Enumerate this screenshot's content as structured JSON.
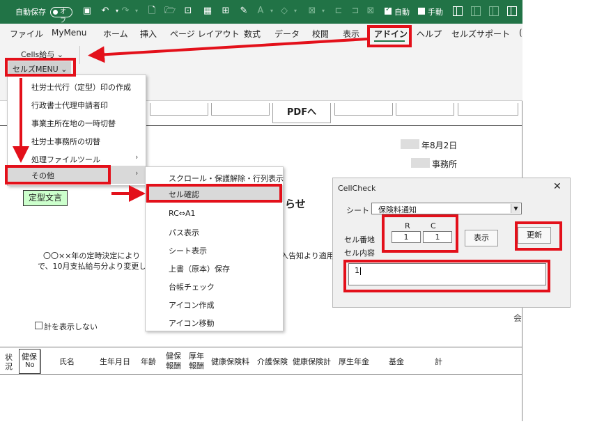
{
  "titlebar": {
    "autosave_label": "自動保存",
    "autosave_state": "オフ",
    "auto_label": "自動",
    "manual_label": "手動"
  },
  "tabs": [
    {
      "label": "ファイル"
    },
    {
      "label": "MyMenu"
    },
    {
      "label": "ホーム"
    },
    {
      "label": "挿入"
    },
    {
      "label": "ページ レイアウト"
    },
    {
      "label": "数式"
    },
    {
      "label": "データ"
    },
    {
      "label": "校閲"
    },
    {
      "label": "表示"
    },
    {
      "label": "アドイン",
      "active": true
    },
    {
      "label": "ヘルプ"
    },
    {
      "label": "セルズサポート"
    }
  ],
  "ribbon": {
    "cells_salary": "Cells給与",
    "cellz_menu": "セルズMENU"
  },
  "menu_main": [
    {
      "label": "社労士代行（定型）印の作成"
    },
    {
      "label": "行政書士代理申請者印"
    },
    {
      "label": "事業主所在地の一時切替"
    },
    {
      "label": "社労士事務所の切替"
    },
    {
      "label": "処理ファイルツール",
      "submenu": true
    },
    {
      "label": "その他",
      "submenu": true
    }
  ],
  "menu_sub": [
    {
      "label": "スクロール・保護解除・行列表示"
    },
    {
      "label": "セル確認"
    },
    {
      "label": "RC⇔A1"
    },
    {
      "label": "パス表示"
    },
    {
      "label": "シート表示"
    },
    {
      "label": "上書（原本）保存"
    },
    {
      "label": "台帳チェック"
    },
    {
      "label": "アイコン作成"
    },
    {
      "label": "アイコン移動"
    }
  ],
  "sheet": {
    "pdf_button": "PDFへ",
    "date": "年8月2日",
    "office": "事務所",
    "teikei_button": "定型文言",
    "notice_suffix": "らせ",
    "body_line1": "〇〇××年の定時決定により",
    "body_line1b": "入告知より適用",
    "body_line2": "で、10月支払給与分より変更して",
    "checkbox_label": "計を表示しない",
    "right_char": "会",
    "headers": {
      "status_1": "状",
      "status_2": "況",
      "health_no_1": "健保",
      "health_no_2": "No",
      "name": "氏名",
      "birth": "生年月日",
      "age": "年齢",
      "hr_1": "健保",
      "hr_2": "報酬",
      "pr_1": "厚年",
      "pr_2": "報酬",
      "health_premium": "健康保険料",
      "care_insurance": "介護保険",
      "health_total": "健康保険計",
      "pension": "厚生年金",
      "fund": "基金",
      "total": "計"
    }
  },
  "dialog": {
    "title": "CellCheck",
    "sheet_label": "シート",
    "sheet_value": "保険料通知",
    "r_label": "R",
    "c_label": "C",
    "cell_addr_label": "セル番地",
    "cell_content_label": "セル内容",
    "r_value": "1",
    "c_value": "1",
    "show_button": "表示",
    "refresh_button": "更新",
    "content_value": "1"
  }
}
